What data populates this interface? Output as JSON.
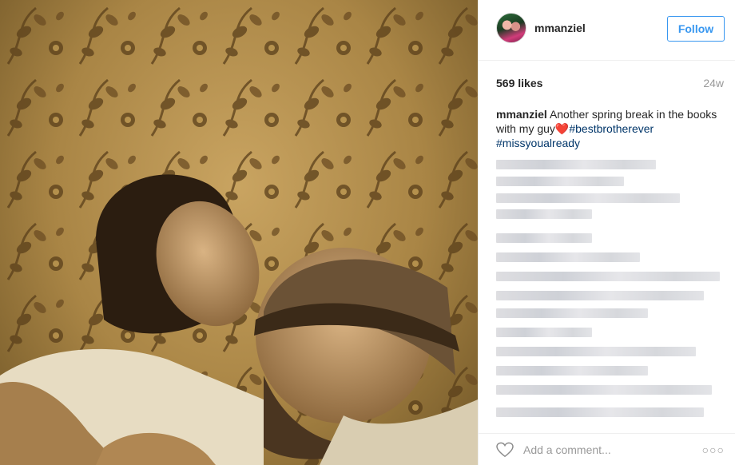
{
  "post": {
    "photo": {
      "name": "post-photo"
    },
    "header": {
      "username": "mmanziel",
      "follow_label": "Follow"
    },
    "stats": {
      "likes": "569 likes",
      "age": "24w"
    },
    "caption": {
      "username": "mmanziel",
      "text": "Another spring break in the books with my guy",
      "emoji": "❤️",
      "hashtags": [
        "#bestbrotherever",
        "#missyoualready"
      ]
    },
    "comments_blurred": true,
    "footer": {
      "comment_placeholder": "Add a comment...",
      "more_label": "○○○"
    }
  },
  "colors": {
    "accent": "#3897f0",
    "hashtag": "#003569",
    "muted": "#999999",
    "border": "#efefef"
  },
  "icons": {
    "like": "heart-outline-icon",
    "more": "more-options-icon"
  }
}
